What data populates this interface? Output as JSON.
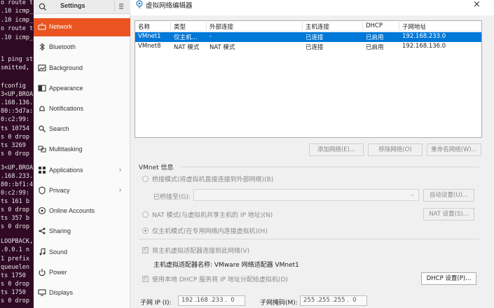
{
  "terminal": {
    "lines": [
      "o route t",
      ".10 icmp_",
      ".10 icmp_",
      "o route t",
      ".10 icmp_",
      "1 ping st",
      "smitted,",
      "fconfig",
      "3<UP,BROA",
      ".168.136.",
      "80::5d7a:",
      "0:c2:99:",
      "ts 10754",
      "s 0 drop",
      "ts 3269",
      "s 0 drop",
      "3<UP,BROA",
      ".168.233.",
      "80::bf1:4",
      "0:c2:99:",
      "ts 161 b",
      "s 0 drop",
      "ts 357 b",
      "s 0 drop",
      "LOOPBACK,",
      ".0.0.1 n",
      "1 prefix",
      "queuelen",
      "ts 1750",
      "s 0 drop",
      "ts 1750",
      "s 0 drop"
    ]
  },
  "settings": {
    "title": "Settings",
    "items": [
      {
        "label": "Network",
        "icon": "network-icon",
        "active": true
      },
      {
        "label": "Bluetooth",
        "icon": "bluetooth-icon"
      },
      {
        "label": "Background",
        "icon": "background-icon"
      },
      {
        "label": "Appearance",
        "icon": "appearance-icon"
      },
      {
        "label": "Notifications",
        "icon": "bell-icon"
      },
      {
        "label": "Search",
        "icon": "search-icon"
      },
      {
        "label": "Multitasking",
        "icon": "multitasking-icon"
      },
      {
        "label": "Applications",
        "icon": "applications-icon",
        "chevron": "›"
      },
      {
        "label": "Privacy",
        "icon": "privacy-icon",
        "chevron": "›"
      },
      {
        "label": "Online Accounts",
        "icon": "online-accounts-icon"
      },
      {
        "label": "Sharing",
        "icon": "sharing-icon"
      },
      {
        "label": "Sound",
        "icon": "music-note-icon"
      },
      {
        "label": "Power",
        "icon": "power-icon"
      },
      {
        "label": "Displays",
        "icon": "displays-icon"
      }
    ]
  },
  "dialog": {
    "title": "虚拟网络编辑器",
    "close": "×",
    "columns": [
      "名称",
      "类型",
      "外部连接",
      "主机连接",
      "DHCP",
      "子网地址"
    ],
    "rows": [
      {
        "name": "VMnet1",
        "type": "仅主机...",
        "external": "-",
        "host": "已连接",
        "dhcp": "已启用",
        "subnet": "192.168.233.0",
        "selected": true
      },
      {
        "name": "VMnet8",
        "type": "NAT 模式",
        "external": "NAT 模式",
        "host": "已连接",
        "dhcp": "已启用",
        "subnet": "192.168.136.0",
        "selected": false
      }
    ],
    "buttons": {
      "add": "添加网络(E)...",
      "remove": "移除网络(O)",
      "rename": "重命名网络(W)..."
    },
    "vmnet_info": "VMnet 信息",
    "bridged": "桥接模式(将虚拟机直接连接到外部网络)(B)",
    "bridged_to": "已桥接至(G):",
    "auto_settings": "自动设置(U)...",
    "nat": "NAT 模式(与虚拟机共享主机的 IP 地址)(N)",
    "nat_settings": "NAT 设置(S)...",
    "host_only": "仅主机模式(在专用网络内连接虚拟机)(H)",
    "connect_adapter": "将主机虚拟适配器连接到此网络(V)",
    "adapter_name": "主机虚拟适配器名称: VMware 网络适配器 VMnet1",
    "use_dhcp": "使用本地 DHCP 服务将 IP 地址分配给虚拟机(D)",
    "dhcp_settings": "DHCP 设置(P)...",
    "subnet_ip_label": "子网 IP (I):",
    "subnet_ip": "192 .168 .233 .  0",
    "subnet_mask_label": "子网掩码(M):",
    "subnet_mask": "255 .255 .255 .  0"
  }
}
